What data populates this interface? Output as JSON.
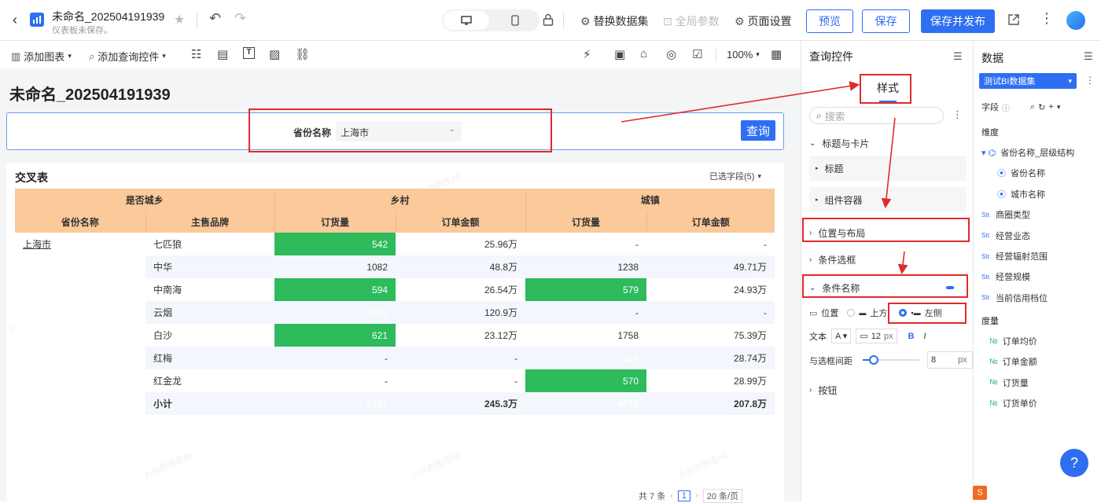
{
  "header": {
    "title": "未命名_202504191939",
    "subtitle": "仪表板未保存。",
    "replace_dataset": "替换数据集",
    "global_params": "全局参数",
    "page_settings": "页面设置",
    "preview": "预览",
    "save": "保存",
    "save_publish": "保存并发布"
  },
  "toolbar": {
    "add_chart": "添加图表",
    "add_query": "添加查询控件",
    "zoom": "100%"
  },
  "canvas": {
    "page_title": "未命名_202504191939",
    "query": {
      "label": "省份名称",
      "value": "上海市",
      "button": "查询"
    },
    "watermark": "六月的雨在Ali",
    "table_title": "交叉表",
    "selected_fields": "已选字段(5)",
    "headers": {
      "row_group": "是否城乡",
      "col1": "省份名称",
      "col2": "主售品牌",
      "group_a": "乡村",
      "group_b": "城镇",
      "qty": "订货量",
      "amount": "订单金额"
    },
    "province": "上海市",
    "rows": [
      {
        "brand": "七匹狼",
        "a_qty": "542",
        "a_amt": "25.96万",
        "b_qty": "-",
        "b_amt": "-"
      },
      {
        "brand": "中华",
        "a_qty": "1082",
        "a_amt": "48.8万",
        "b_qty": "1238",
        "b_amt": "49.71万"
      },
      {
        "brand": "中南海",
        "a_qty": "594",
        "a_amt": "26.54万",
        "b_qty": "579",
        "b_amt": "24.93万"
      },
      {
        "brand": "云烟",
        "a_qty": "3062",
        "a_amt": "120.9万",
        "b_qty": "-",
        "b_amt": "-"
      },
      {
        "brand": "白沙",
        "a_qty": "621",
        "a_amt": "23.12万",
        "b_qty": "1758",
        "b_amt": "75.39万"
      },
      {
        "brand": "红梅",
        "a_qty": "-",
        "a_amt": "-",
        "b_qty": "629",
        "b_amt": "28.74万"
      },
      {
        "brand": "红金龙",
        "a_qty": "-",
        "a_amt": "-",
        "b_qty": "570",
        "b_amt": "28.99万"
      },
      {
        "brand": "小计",
        "a_qty": "5901",
        "a_amt": "245.3万",
        "b_qty": "4774",
        "b_amt": "207.8万"
      }
    ],
    "pagination": {
      "total": "共 7 条",
      "page": "1",
      "page_size": "20 条/页"
    }
  },
  "query_panel": {
    "title": "查询控件",
    "tab": "样式",
    "search_placeholder": "搜索",
    "sections": {
      "title_card": "标题与卡片",
      "title": "标题",
      "container": "组件容器",
      "position_layout": "位置与布局",
      "condition_box": "条件选框",
      "condition_name": "条件名称",
      "buttons": "按钮"
    },
    "position_label": "位置",
    "position_top": "上方",
    "position_left": "左侧",
    "text_label": "文本",
    "font_size": "12",
    "font_unit": "px",
    "gap_label": "与选框间距",
    "gap_value": "8",
    "gap_unit": "px"
  },
  "data_panel": {
    "title": "数据",
    "dataset": "测试BI数据集",
    "fields": "字段",
    "dimension": "维度",
    "dims": [
      "省份名称_层级结构",
      "省份名称",
      "城市名称",
      "商圈类型",
      "经营业态",
      "经营辐射范围",
      "经营规模",
      "当前信用档位"
    ],
    "measure": "度量",
    "measures": [
      "订单均价",
      "订单金额",
      "订货量",
      "订货单价"
    ]
  },
  "colors": {
    "accent": "#2e6ff2",
    "green": "#2dbb5c",
    "red": "#fb4d5d",
    "header": "#fcc99a",
    "annotation": "#e02b2b"
  }
}
